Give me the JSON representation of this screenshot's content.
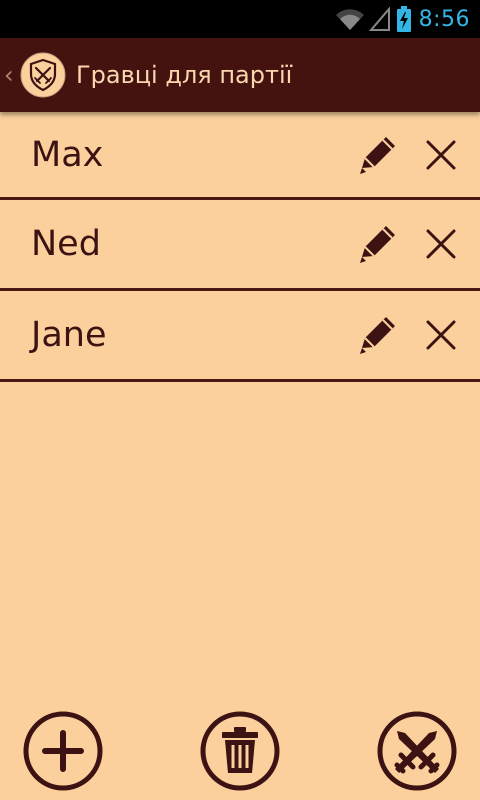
{
  "status_bar": {
    "time": "8:56",
    "icons": [
      "wifi-icon",
      "signal-icon",
      "battery-charging-icon"
    ]
  },
  "action_bar": {
    "up_caret": "‹",
    "title": "Гравці для партії",
    "logo_icon": "shield-crossed-swords-icon"
  },
  "players": [
    {
      "name": "Max"
    },
    {
      "name": "Ned"
    },
    {
      "name": "Jane"
    }
  ],
  "row_actions": {
    "edit_icon": "pencil-icon",
    "delete_icon": "close-icon"
  },
  "bottom_buttons": [
    {
      "icon": "add-icon"
    },
    {
      "icon": "trash-icon"
    },
    {
      "icon": "crossed-swords-icon"
    }
  ],
  "colors": {
    "background": "#fbd09d",
    "action_bar": "#44120f",
    "title_text": "#fbd7b0",
    "primary_dark": "#3c1312",
    "clock": "#33b5e5"
  }
}
